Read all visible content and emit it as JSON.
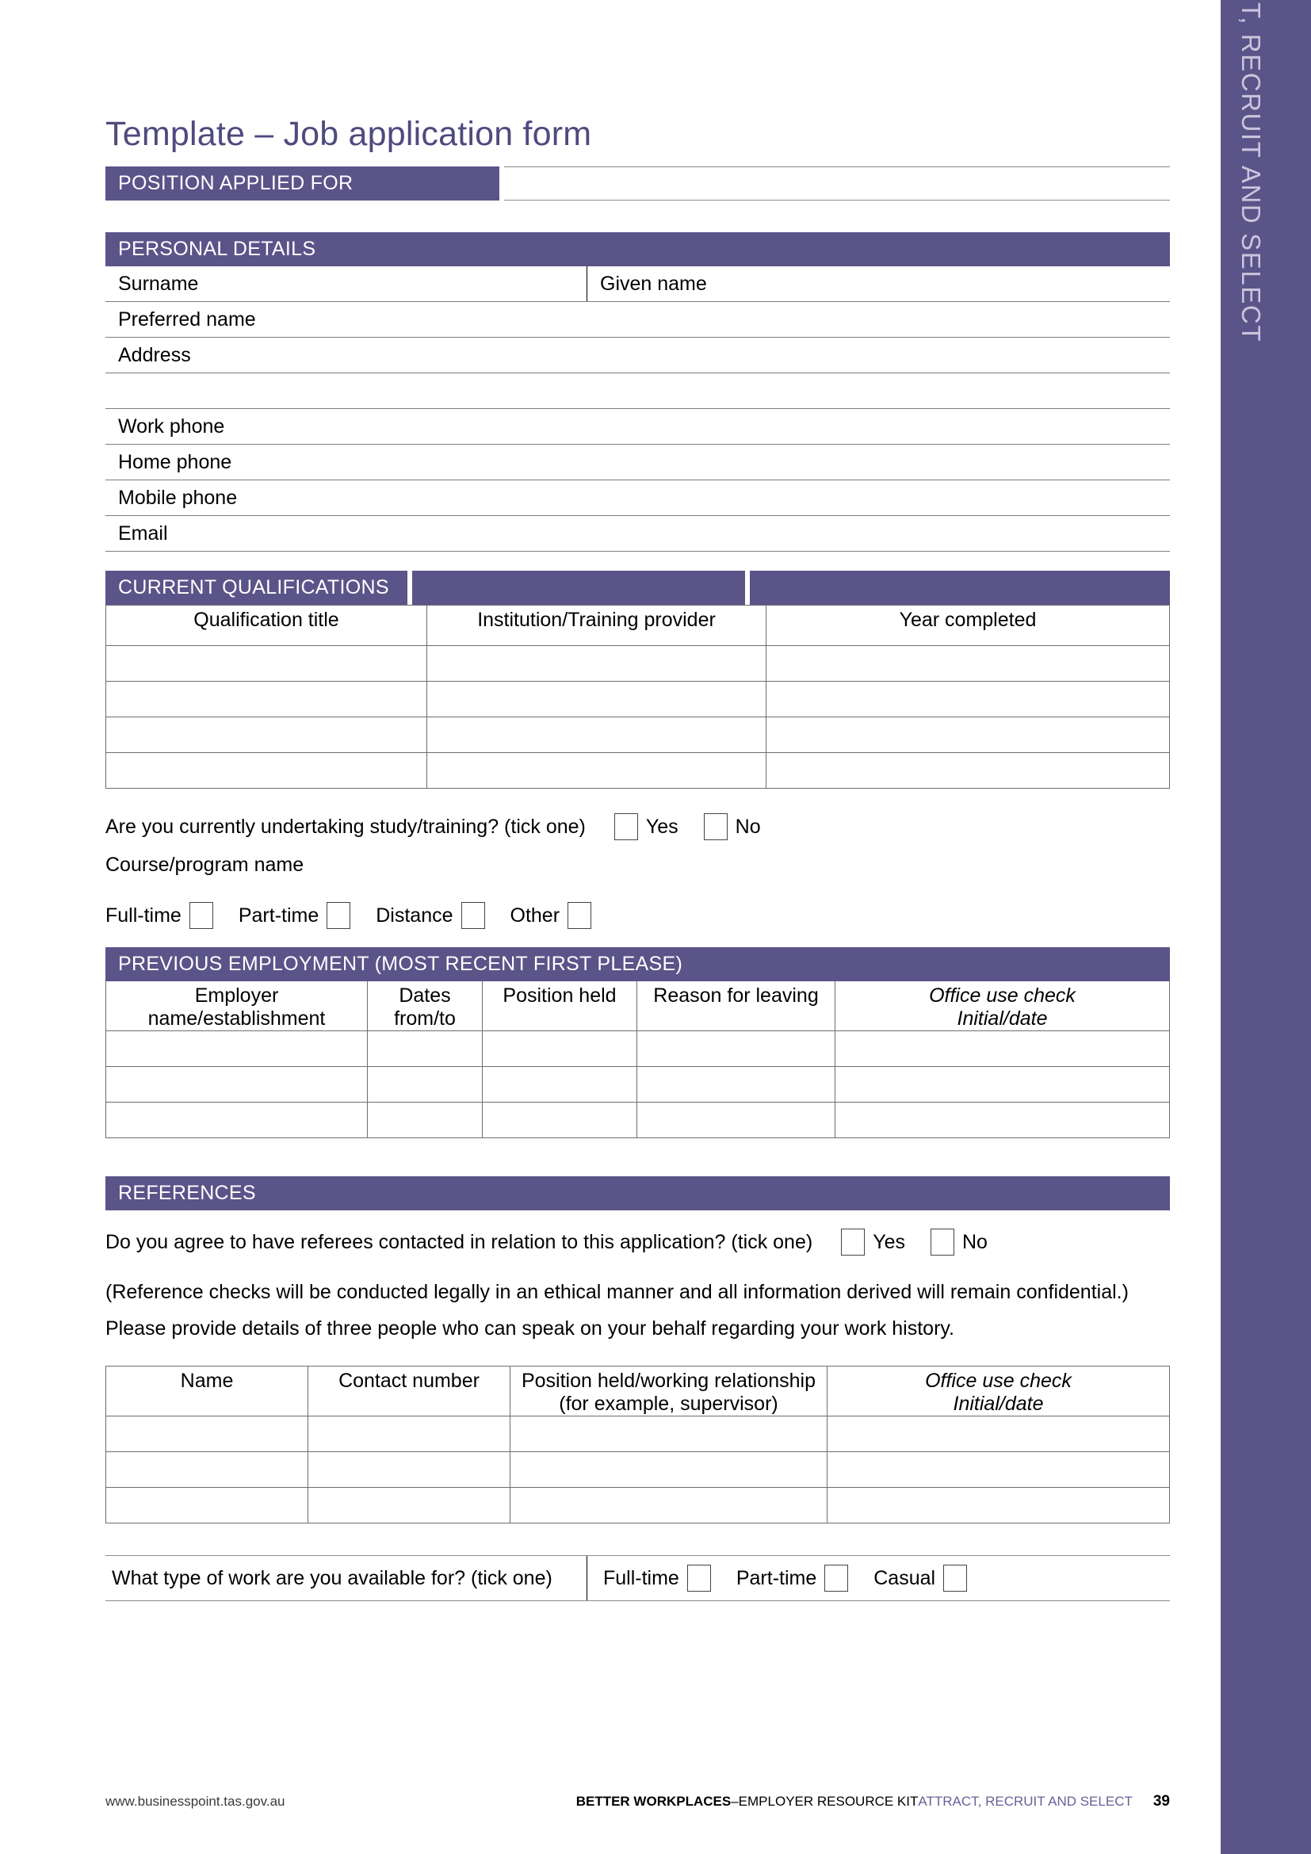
{
  "side_tab": {
    "label": "ATTRACT, RECRUIT AND SELECT"
  },
  "document": {
    "title": "Template – Job application form"
  },
  "colors": {
    "purple": "#5b5489",
    "title_purple": "#4f4a7e",
    "side_tab_text": "#c9c5dc"
  },
  "position_applied": {
    "heading": "POSITION APPLIED FOR"
  },
  "personal_details": {
    "heading": "PERSONAL DETAILS",
    "rows": [
      {
        "left": "Surname",
        "right": "Given name",
        "split": true
      },
      {
        "left": "Preferred name",
        "right": "",
        "split": false
      },
      {
        "left": "Address",
        "right": "",
        "split": false
      },
      {
        "left": "",
        "right": "",
        "split": false
      },
      {
        "left": "Work phone",
        "right": "",
        "split": false
      },
      {
        "left": "Home phone",
        "right": "",
        "split": false
      },
      {
        "left": "Mobile phone",
        "right": "",
        "split": false
      },
      {
        "left": "Email",
        "right": "",
        "split": false
      }
    ]
  },
  "qualifications": {
    "heading": "CURRENT QUALIFICATIONS",
    "columns": [
      "Qualification title",
      "Institution/Training provider",
      "Year completed"
    ],
    "empty_rows": 4,
    "study_question": {
      "text": "Are you currently undertaking study/training? (tick one)",
      "options": [
        "Yes",
        "No"
      ]
    },
    "course_label": "Course/program name",
    "study_modes": [
      "Full-time",
      "Part-time",
      "Distance",
      "Other"
    ]
  },
  "previous_employment": {
    "heading": "PREVIOUS EMPLOYMENT (MOST RECENT FIRST PLEASE)",
    "columns": [
      {
        "line1": "Employer name/establishment",
        "line2": "",
        "italic": false
      },
      {
        "line1": "Dates",
        "line2": "from/to",
        "italic": false
      },
      {
        "line1": "Position held",
        "line2": "",
        "italic": false
      },
      {
        "line1": "Reason for leaving",
        "line2": "",
        "italic": false
      },
      {
        "line1": "Office use check",
        "line2": "Initial/date",
        "italic": true
      }
    ],
    "empty_rows": 3
  },
  "references": {
    "heading": "REFERENCES",
    "consent_question": {
      "text": "Do you agree to have referees contacted in relation to this application? (tick one)",
      "options": [
        "Yes",
        "No"
      ]
    },
    "note_line1": "(Reference checks will be conducted legally in an ethical manner and all information derived will remain confidential.)",
    "note_line2": "Please provide details of three people who can speak on your behalf regarding your work history.",
    "columns": [
      {
        "line1": "Name",
        "line2": "",
        "italic": false
      },
      {
        "line1": "Contact number",
        "line2": "",
        "italic": false
      },
      {
        "line1": "Position held/working relationship",
        "line2": "(for example, supervisor)",
        "italic": false
      },
      {
        "line1": "Office use check",
        "line2": "Initial/date",
        "italic": true
      }
    ],
    "empty_rows": 3
  },
  "availability": {
    "question": "What type of work are you available for? (tick one)",
    "options": [
      "Full-time",
      "Part-time",
      "Casual"
    ]
  },
  "footer": {
    "website": "www.businesspoint.tas.gov.au",
    "brand": "BETTER WORKPLACES",
    "dash": " – ",
    "kit": "EMPLOYER RESOURCE KIT ",
    "section": "ATTRACT, RECRUIT AND SELECT",
    "page_number": "39"
  }
}
